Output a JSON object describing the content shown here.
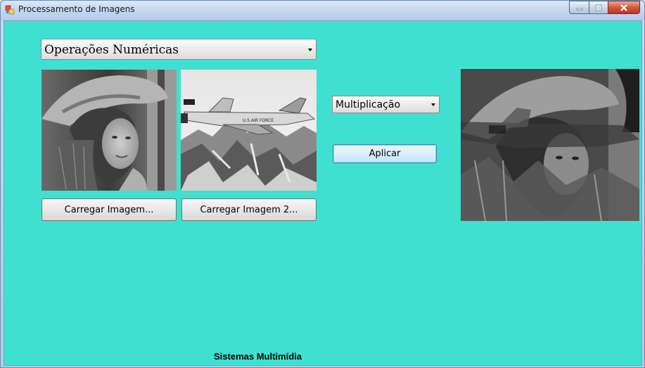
{
  "window": {
    "title": "Processamento de Imagens"
  },
  "main": {
    "operation_category": {
      "selected": "Operações Numéricas"
    },
    "operation": {
      "selected": "Multiplicação"
    },
    "apply_label": "Aplicar",
    "load_image1_label": "Carregar Imagem...",
    "load_image2_label": "Carregar Imagem 2...",
    "footer_label": "Sistemas Multimídia"
  },
  "images": {
    "image1": "grayscale-portrait",
    "image2": "grayscale-jet",
    "result": "grayscale-multiplied"
  },
  "colors": {
    "client_background": "#40e0d0"
  }
}
